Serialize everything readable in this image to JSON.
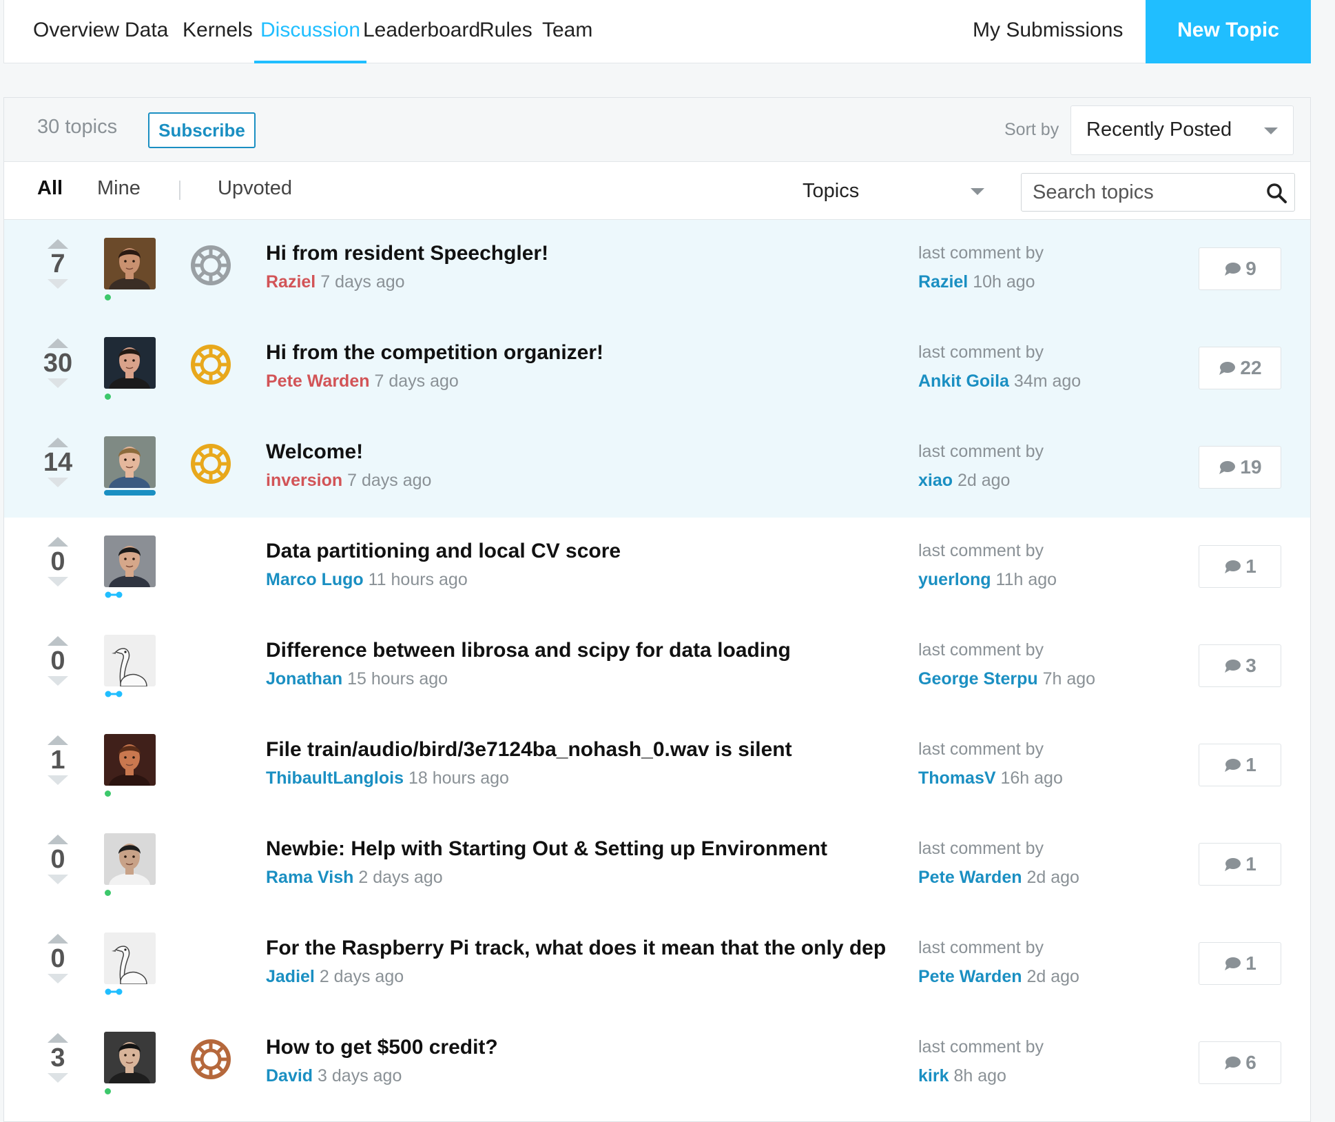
{
  "nav": {
    "tabs": [
      {
        "label": "Overview"
      },
      {
        "label": "Data"
      },
      {
        "label": "Kernels"
      },
      {
        "label": "Discussion",
        "active": true
      },
      {
        "label": "Leaderboard"
      },
      {
        "label": "Rules"
      },
      {
        "label": "Team"
      }
    ],
    "my_submissions": "My Submissions",
    "new_topic": "New Topic"
  },
  "toolbar": {
    "topic_count": "30 topics",
    "subscribe": "Subscribe",
    "sort_label": "Sort by",
    "sort_value": "Recently Posted"
  },
  "filters": {
    "all": "All",
    "mine": "Mine",
    "upvoted": "Upvoted",
    "topics_select": "Topics",
    "search_placeholder": "Search topics"
  },
  "colors": {
    "accent": "#20beff",
    "link_blue": "#1a8fc2",
    "author_red": "#d25457",
    "pinned_bg": "#edf8fc",
    "medal_gold": "#e8a81c",
    "medal_silver": "#9aa0a4",
    "medal_bronze": "#b5683c"
  },
  "last_comment_label": "last comment by",
  "topics": [
    {
      "votes": "7",
      "title": "Hi from resident Speechgler!",
      "author": "Raziel",
      "time": "7 days ago",
      "last_by": "Raziel",
      "last_time": "10h ago",
      "comments": "9",
      "medal": "silver",
      "status": "dot",
      "pinned": true,
      "author_style": "red",
      "avatar": "a1"
    },
    {
      "votes": "30",
      "title": "Hi from the competition organizer!",
      "author": "Pete Warden",
      "time": "7 days ago",
      "last_by": "Ankit Goila",
      "last_time": "34m ago",
      "comments": "22",
      "medal": "gold",
      "status": "dot",
      "pinned": true,
      "author_style": "red",
      "avatar": "a2"
    },
    {
      "votes": "14",
      "title": "Welcome!",
      "author": "inversion",
      "time": "7 days ago",
      "last_by": "xiao",
      "last_time": "2d ago",
      "comments": "19",
      "medal": "gold",
      "status": "bar",
      "pinned": true,
      "author_style": "red",
      "avatar": "a3"
    },
    {
      "votes": "0",
      "title": "Data partitioning and local CV score",
      "author": "Marco Lugo",
      "time": "11 hours ago",
      "last_by": "yuerlong",
      "last_time": "11h ago",
      "comments": "1",
      "medal": "",
      "status": "tier",
      "pinned": false,
      "author_style": "blue",
      "avatar": "a4"
    },
    {
      "votes": "0",
      "title": "Difference between librosa and scipy for data loading",
      "author": "Jonathan",
      "time": "15 hours ago",
      "last_by": "George Sterpu",
      "last_time": "7h ago",
      "comments": "3",
      "medal": "",
      "status": "tier",
      "pinned": false,
      "author_style": "blue",
      "avatar": "goose"
    },
    {
      "votes": "1",
      "title": "File train/audio/bird/3e7124ba_nohash_0.wav is silent",
      "author": "ThibaultLanglois",
      "time": "18 hours ago",
      "last_by": "ThomasV",
      "last_time": "16h ago",
      "comments": "1",
      "medal": "",
      "status": "dot",
      "pinned": false,
      "author_style": "blue",
      "avatar": "a6"
    },
    {
      "votes": "0",
      "title": "Newbie: Help with Starting Out & Setting up Environment",
      "author": "Rama Vish",
      "time": "2 days ago",
      "last_by": "Pete Warden",
      "last_time": "2d ago",
      "comments": "1",
      "medal": "",
      "status": "dot",
      "pinned": false,
      "author_style": "blue",
      "avatar": "a7"
    },
    {
      "votes": "0",
      "title": "For the Raspberry Pi track, what does it mean that the only depe...",
      "author": "Jadiel",
      "time": "2 days ago",
      "last_by": "Pete Warden",
      "last_time": "2d ago",
      "comments": "1",
      "medal": "",
      "status": "tier",
      "pinned": false,
      "author_style": "blue",
      "avatar": "goose"
    },
    {
      "votes": "3",
      "title": "How to get $500 credit?",
      "author": "David",
      "time": "3 days ago",
      "last_by": "kirk",
      "last_time": "8h ago",
      "comments": "6",
      "medal": "bronze",
      "status": "dot",
      "pinned": false,
      "author_style": "blue",
      "avatar": "a9"
    }
  ]
}
